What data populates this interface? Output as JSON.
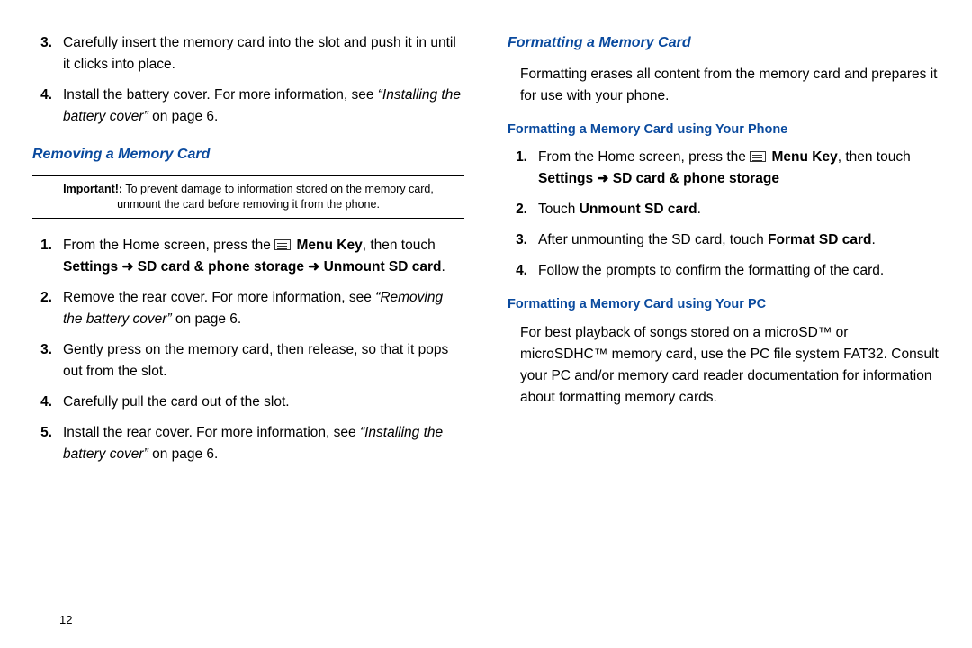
{
  "left": {
    "continued": [
      {
        "num": "3.",
        "text": "Carefully insert the memory card into the slot and push it in until it clicks into place."
      },
      {
        "num": "4.",
        "before": "Install the battery cover. For more information, see ",
        "italic": "“Installing the battery cover”",
        "after": " on page 6."
      }
    ],
    "removing_h": "Removing a Memory Card",
    "important_label": "Important!:",
    "important_text": " To prevent damage to information stored on the memory card, unmount the card before removing it from the phone.",
    "removing_steps": [
      {
        "num": "1.",
        "r": [
          {
            "t": "From the Home screen, press the "
          },
          {
            "icon": true
          },
          {
            "t": " "
          },
          {
            "t": "Menu Key",
            "b": true
          },
          {
            "t": ", then touch "
          },
          {
            "t": "Settings",
            "b": true
          },
          {
            "t": " "
          },
          {
            "arrow": "➜"
          },
          {
            "t": " "
          },
          {
            "t": "SD card & phone storage",
            "b": true
          },
          {
            "t": "  "
          },
          {
            "arrow": "➜"
          },
          {
            "t": " "
          },
          {
            "t": "Unmount SD card",
            "b": true
          },
          {
            "t": "."
          }
        ]
      },
      {
        "num": "2.",
        "r": [
          {
            "t": "Remove the rear cover. For more information, see "
          },
          {
            "t": "“Removing the battery cover”",
            "i": true
          },
          {
            "t": " on page 6."
          }
        ]
      },
      {
        "num": "3.",
        "r": [
          {
            "t": "Gently press on the memory card, then release, so that it pops out from the slot."
          }
        ]
      },
      {
        "num": "4.",
        "r": [
          {
            "t": "Carefully pull the card out of the slot."
          }
        ]
      },
      {
        "num": "5.",
        "r": [
          {
            "t": "Install the rear cover. For more information, see "
          },
          {
            "t": "“Installing the battery cover”",
            "i": true
          },
          {
            "t": " on page 6."
          }
        ]
      }
    ],
    "page_number": "12"
  },
  "right": {
    "formatting_h": "Formatting a Memory Card",
    "formatting_p": "Formatting erases all content from the memory card and prepares it for use with your phone.",
    "phone_h": "Formatting a Memory Card using Your Phone",
    "phone_steps": [
      {
        "num": "1.",
        "r": [
          {
            "t": "From the Home screen, press the "
          },
          {
            "icon": true
          },
          {
            "t": " "
          },
          {
            "t": "Menu Key",
            "b": true
          },
          {
            "t": ", then touch "
          },
          {
            "t": "Settings",
            "b": true
          },
          {
            "t": " "
          },
          {
            "arrow": "➜"
          },
          {
            "t": " "
          },
          {
            "t": "SD card & phone storage",
            "b": true
          }
        ]
      },
      {
        "num": "2.",
        "r": [
          {
            "t": "Touch "
          },
          {
            "t": "Unmount SD card",
            "b": true
          },
          {
            "t": "."
          }
        ]
      },
      {
        "num": "3.",
        "r": [
          {
            "t": "After unmounting the SD card, touch "
          },
          {
            "t": "Format SD card",
            "b": true
          },
          {
            "t": "."
          }
        ]
      },
      {
        "num": "4.",
        "r": [
          {
            "t": "Follow the prompts to confirm the formatting of the card."
          }
        ]
      }
    ],
    "pc_h": "Formatting a Memory Card using Your PC",
    "pc_p": "For best playback of songs stored on a microSD™ or microSDHC™ memory card, use the PC file system FAT32. Consult your PC and/or memory card reader documentation for information about formatting memory cards."
  }
}
